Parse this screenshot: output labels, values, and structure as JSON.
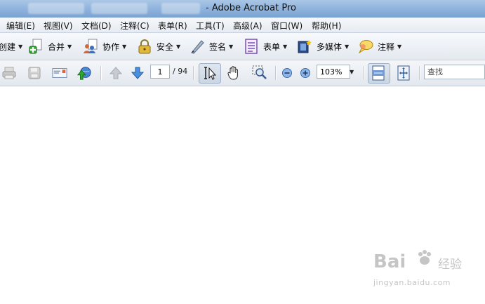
{
  "title": {
    "app": "- Adobe Acrobat Pro",
    "doc_blurred": "部级项目...专用JC"
  },
  "menu": [
    {
      "id": "edit",
      "label": "编辑(E)"
    },
    {
      "id": "view",
      "label": "视图(V)"
    },
    {
      "id": "document",
      "label": "文档(D)"
    },
    {
      "id": "comment",
      "label": "注释(C)"
    },
    {
      "id": "forms",
      "label": "表单(R)"
    },
    {
      "id": "tools",
      "label": "工具(T)"
    },
    {
      "id": "advanced",
      "label": "高级(A)"
    },
    {
      "id": "window",
      "label": "窗口(W)"
    },
    {
      "id": "help",
      "label": "帮助(H)"
    }
  ],
  "tasks": [
    {
      "id": "create",
      "label": "创建",
      "icon": "create-icon"
    },
    {
      "id": "combine",
      "label": "合并",
      "icon": "combine-plus-icon"
    },
    {
      "id": "collaborate",
      "label": "协作",
      "icon": "collaborate-icon"
    },
    {
      "id": "secure",
      "label": "安全",
      "icon": "lock-icon"
    },
    {
      "id": "sign",
      "label": "签名",
      "icon": "pen-icon"
    },
    {
      "id": "forms",
      "label": "表单",
      "icon": "form-icon"
    },
    {
      "id": "multimedia",
      "label": "多媒体",
      "icon": "film-icon"
    },
    {
      "id": "comment",
      "label": "注释",
      "icon": "speech-bubble-icon"
    }
  ],
  "nav": {
    "page_current": "1",
    "page_total": "/ 94",
    "zoom": "103%",
    "search_placeholder": "查找"
  },
  "watermark": {
    "logo": "Bai",
    "logo2": "u",
    "jingyan": "经验",
    "url": "jingyan.baidu.com"
  }
}
